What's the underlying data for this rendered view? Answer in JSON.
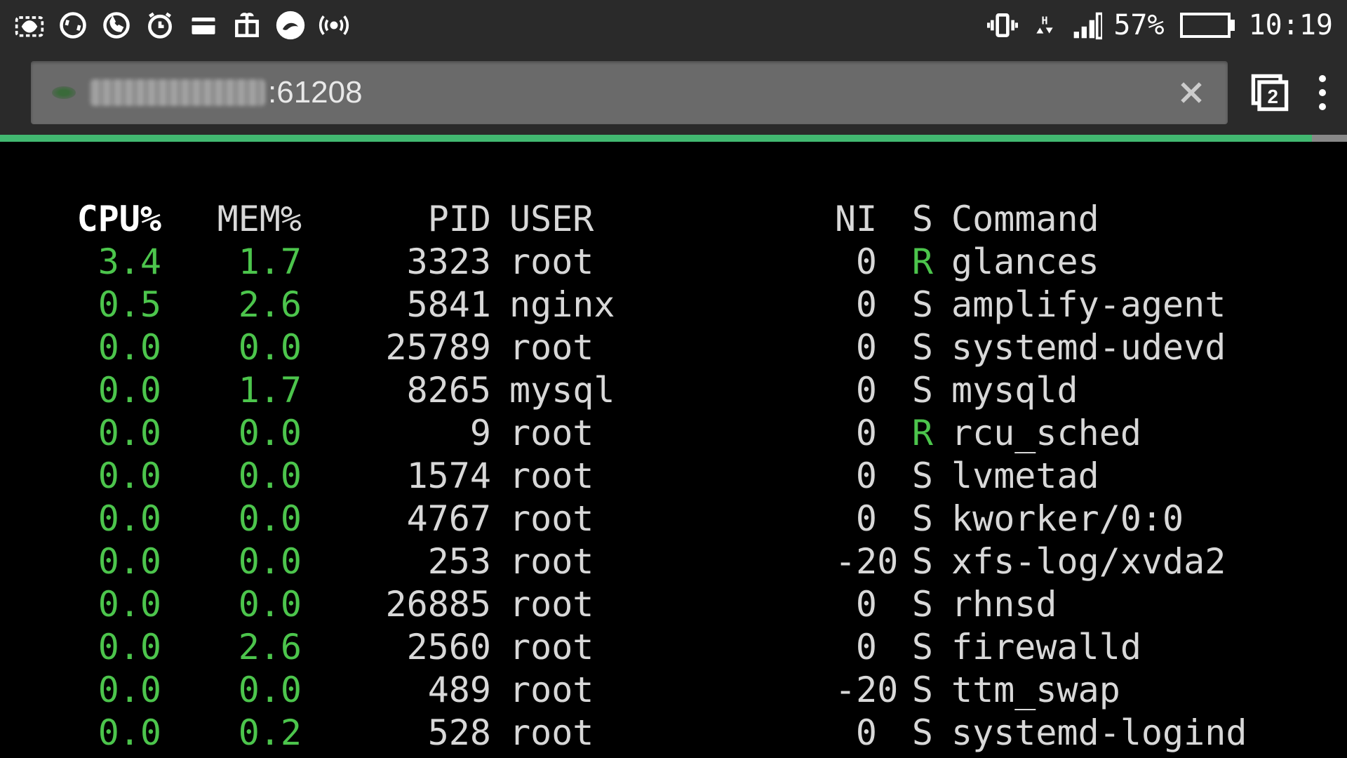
{
  "status_bar": {
    "battery_pct": "57%",
    "clock": "10:19",
    "tab_count": "2"
  },
  "browser": {
    "url_visible": ":61208"
  },
  "table": {
    "headers": {
      "cpu": "CPU%",
      "mem": "MEM%",
      "pid": "PID",
      "user": "USER",
      "ni": "NI",
      "s": "S",
      "cmd": "Command"
    },
    "rows": [
      {
        "cpu": "3.4",
        "mem": "1.7",
        "pid": "3323",
        "user": "root",
        "ni": "0",
        "s": "R",
        "cmd": "glances",
        "s_green": true
      },
      {
        "cpu": "0.5",
        "mem": "2.6",
        "pid": "5841",
        "user": "nginx",
        "ni": "0",
        "s": "S",
        "cmd": "amplify-agent",
        "s_green": false
      },
      {
        "cpu": "0.0",
        "mem": "0.0",
        "pid": "25789",
        "user": "root",
        "ni": "0",
        "s": "S",
        "cmd": "systemd-udevd",
        "s_green": false
      },
      {
        "cpu": "0.0",
        "mem": "1.7",
        "pid": "8265",
        "user": "mysql",
        "ni": "0",
        "s": "S",
        "cmd": "mysqld",
        "s_green": false
      },
      {
        "cpu": "0.0",
        "mem": "0.0",
        "pid": "9",
        "user": "root",
        "ni": "0",
        "s": "R",
        "cmd": "rcu_sched",
        "s_green": true
      },
      {
        "cpu": "0.0",
        "mem": "0.0",
        "pid": "1574",
        "user": "root",
        "ni": "0",
        "s": "S",
        "cmd": "lvmetad",
        "s_green": false
      },
      {
        "cpu": "0.0",
        "mem": "0.0",
        "pid": "4767",
        "user": "root",
        "ni": "0",
        "s": "S",
        "cmd": "kworker/0:0",
        "s_green": false
      },
      {
        "cpu": "0.0",
        "mem": "0.0",
        "pid": "253",
        "user": "root",
        "ni": "-20",
        "s": "S",
        "cmd": "xfs-log/xvda2",
        "s_green": false
      },
      {
        "cpu": "0.0",
        "mem": "0.0",
        "pid": "26885",
        "user": "root",
        "ni": "0",
        "s": "S",
        "cmd": "rhnsd",
        "s_green": false
      },
      {
        "cpu": "0.0",
        "mem": "2.6",
        "pid": "2560",
        "user": "root",
        "ni": "0",
        "s": "S",
        "cmd": "firewalld",
        "s_green": false
      },
      {
        "cpu": "0.0",
        "mem": "0.0",
        "pid": "489",
        "user": "root",
        "ni": "-20",
        "s": "S",
        "cmd": "ttm_swap",
        "s_green": false
      },
      {
        "cpu": "0.0",
        "mem": "0.2",
        "pid": "528",
        "user": "root",
        "ni": "0",
        "s": "S",
        "cmd": "systemd-logind",
        "s_green": false
      }
    ]
  }
}
